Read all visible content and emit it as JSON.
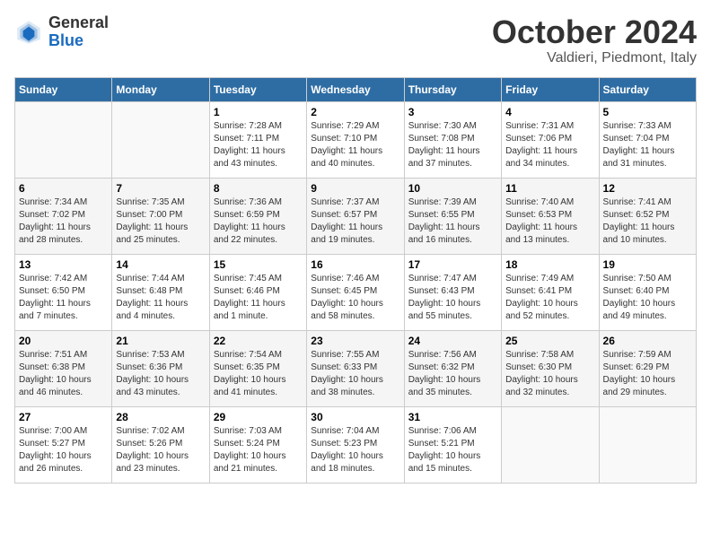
{
  "logo": {
    "general": "General",
    "blue": "Blue"
  },
  "title": "October 2024",
  "subtitle": "Valdieri, Piedmont, Italy",
  "headers": [
    "Sunday",
    "Monday",
    "Tuesday",
    "Wednesday",
    "Thursday",
    "Friday",
    "Saturday"
  ],
  "weeks": [
    [
      {
        "day": "",
        "info": ""
      },
      {
        "day": "",
        "info": ""
      },
      {
        "day": "1",
        "info": "Sunrise: 7:28 AM\nSunset: 7:11 PM\nDaylight: 11 hours\nand 43 minutes."
      },
      {
        "day": "2",
        "info": "Sunrise: 7:29 AM\nSunset: 7:10 PM\nDaylight: 11 hours\nand 40 minutes."
      },
      {
        "day": "3",
        "info": "Sunrise: 7:30 AM\nSunset: 7:08 PM\nDaylight: 11 hours\nand 37 minutes."
      },
      {
        "day": "4",
        "info": "Sunrise: 7:31 AM\nSunset: 7:06 PM\nDaylight: 11 hours\nand 34 minutes."
      },
      {
        "day": "5",
        "info": "Sunrise: 7:33 AM\nSunset: 7:04 PM\nDaylight: 11 hours\nand 31 minutes."
      }
    ],
    [
      {
        "day": "6",
        "info": "Sunrise: 7:34 AM\nSunset: 7:02 PM\nDaylight: 11 hours\nand 28 minutes."
      },
      {
        "day": "7",
        "info": "Sunrise: 7:35 AM\nSunset: 7:00 PM\nDaylight: 11 hours\nand 25 minutes."
      },
      {
        "day": "8",
        "info": "Sunrise: 7:36 AM\nSunset: 6:59 PM\nDaylight: 11 hours\nand 22 minutes."
      },
      {
        "day": "9",
        "info": "Sunrise: 7:37 AM\nSunset: 6:57 PM\nDaylight: 11 hours\nand 19 minutes."
      },
      {
        "day": "10",
        "info": "Sunrise: 7:39 AM\nSunset: 6:55 PM\nDaylight: 11 hours\nand 16 minutes."
      },
      {
        "day": "11",
        "info": "Sunrise: 7:40 AM\nSunset: 6:53 PM\nDaylight: 11 hours\nand 13 minutes."
      },
      {
        "day": "12",
        "info": "Sunrise: 7:41 AM\nSunset: 6:52 PM\nDaylight: 11 hours\nand 10 minutes."
      }
    ],
    [
      {
        "day": "13",
        "info": "Sunrise: 7:42 AM\nSunset: 6:50 PM\nDaylight: 11 hours\nand 7 minutes."
      },
      {
        "day": "14",
        "info": "Sunrise: 7:44 AM\nSunset: 6:48 PM\nDaylight: 11 hours\nand 4 minutes."
      },
      {
        "day": "15",
        "info": "Sunrise: 7:45 AM\nSunset: 6:46 PM\nDaylight: 11 hours\nand 1 minute."
      },
      {
        "day": "16",
        "info": "Sunrise: 7:46 AM\nSunset: 6:45 PM\nDaylight: 10 hours\nand 58 minutes."
      },
      {
        "day": "17",
        "info": "Sunrise: 7:47 AM\nSunset: 6:43 PM\nDaylight: 10 hours\nand 55 minutes."
      },
      {
        "day": "18",
        "info": "Sunrise: 7:49 AM\nSunset: 6:41 PM\nDaylight: 10 hours\nand 52 minutes."
      },
      {
        "day": "19",
        "info": "Sunrise: 7:50 AM\nSunset: 6:40 PM\nDaylight: 10 hours\nand 49 minutes."
      }
    ],
    [
      {
        "day": "20",
        "info": "Sunrise: 7:51 AM\nSunset: 6:38 PM\nDaylight: 10 hours\nand 46 minutes."
      },
      {
        "day": "21",
        "info": "Sunrise: 7:53 AM\nSunset: 6:36 PM\nDaylight: 10 hours\nand 43 minutes."
      },
      {
        "day": "22",
        "info": "Sunrise: 7:54 AM\nSunset: 6:35 PM\nDaylight: 10 hours\nand 41 minutes."
      },
      {
        "day": "23",
        "info": "Sunrise: 7:55 AM\nSunset: 6:33 PM\nDaylight: 10 hours\nand 38 minutes."
      },
      {
        "day": "24",
        "info": "Sunrise: 7:56 AM\nSunset: 6:32 PM\nDaylight: 10 hours\nand 35 minutes."
      },
      {
        "day": "25",
        "info": "Sunrise: 7:58 AM\nSunset: 6:30 PM\nDaylight: 10 hours\nand 32 minutes."
      },
      {
        "day": "26",
        "info": "Sunrise: 7:59 AM\nSunset: 6:29 PM\nDaylight: 10 hours\nand 29 minutes."
      }
    ],
    [
      {
        "day": "27",
        "info": "Sunrise: 7:00 AM\nSunset: 5:27 PM\nDaylight: 10 hours\nand 26 minutes."
      },
      {
        "day": "28",
        "info": "Sunrise: 7:02 AM\nSunset: 5:26 PM\nDaylight: 10 hours\nand 23 minutes."
      },
      {
        "day": "29",
        "info": "Sunrise: 7:03 AM\nSunset: 5:24 PM\nDaylight: 10 hours\nand 21 minutes."
      },
      {
        "day": "30",
        "info": "Sunrise: 7:04 AM\nSunset: 5:23 PM\nDaylight: 10 hours\nand 18 minutes."
      },
      {
        "day": "31",
        "info": "Sunrise: 7:06 AM\nSunset: 5:21 PM\nDaylight: 10 hours\nand 15 minutes."
      },
      {
        "day": "",
        "info": ""
      },
      {
        "day": "",
        "info": ""
      }
    ]
  ]
}
